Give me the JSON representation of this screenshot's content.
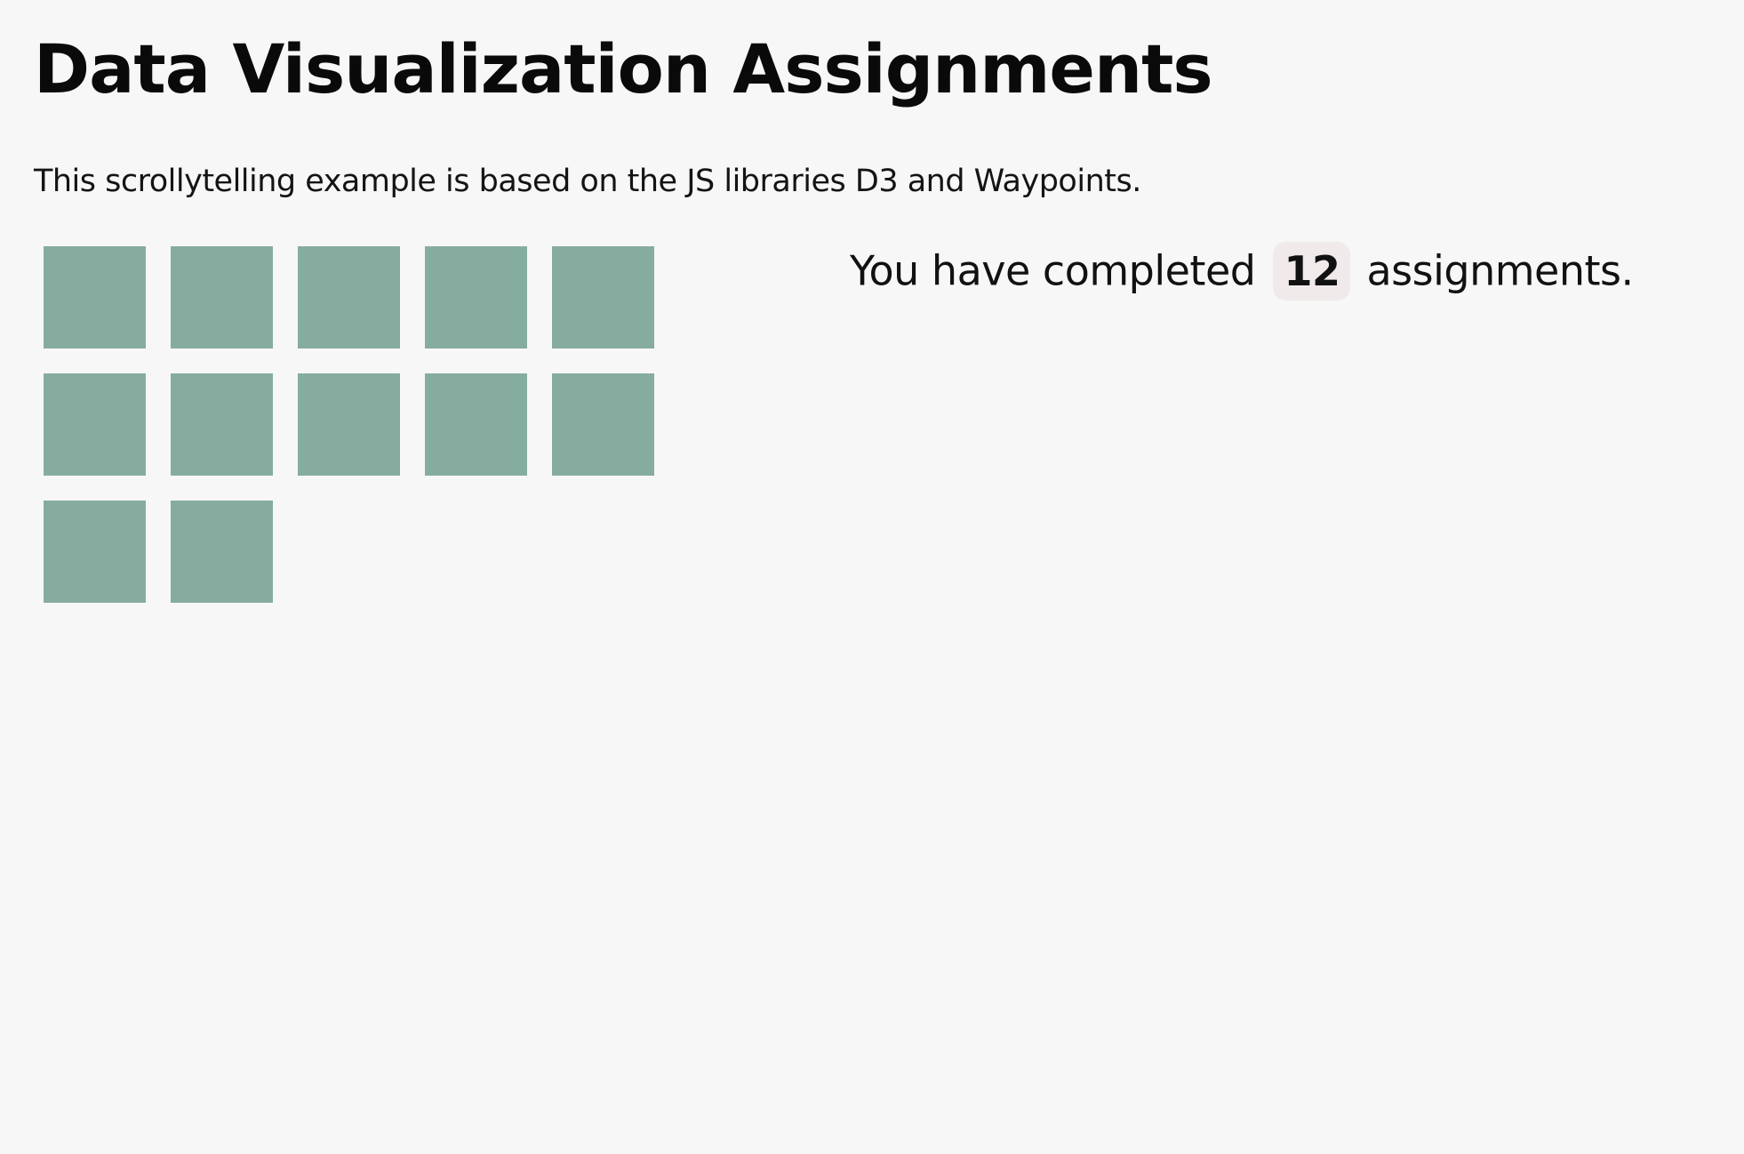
{
  "page": {
    "title": "Data Visualization Assignments",
    "subtitle": "This scrollytelling example is based on the JS libraries D3 and Waypoints."
  },
  "completion": {
    "prefix": "You have completed",
    "count": "12",
    "suffix": "assignments."
  },
  "chart_data": {
    "type": "table",
    "columns_per_row": 5,
    "completed_assignments": 12,
    "square_color": "#86aca0"
  },
  "colors": {
    "background": "#f7f7f7",
    "square": "#86aca0",
    "badge_background": "#f1eaea"
  }
}
